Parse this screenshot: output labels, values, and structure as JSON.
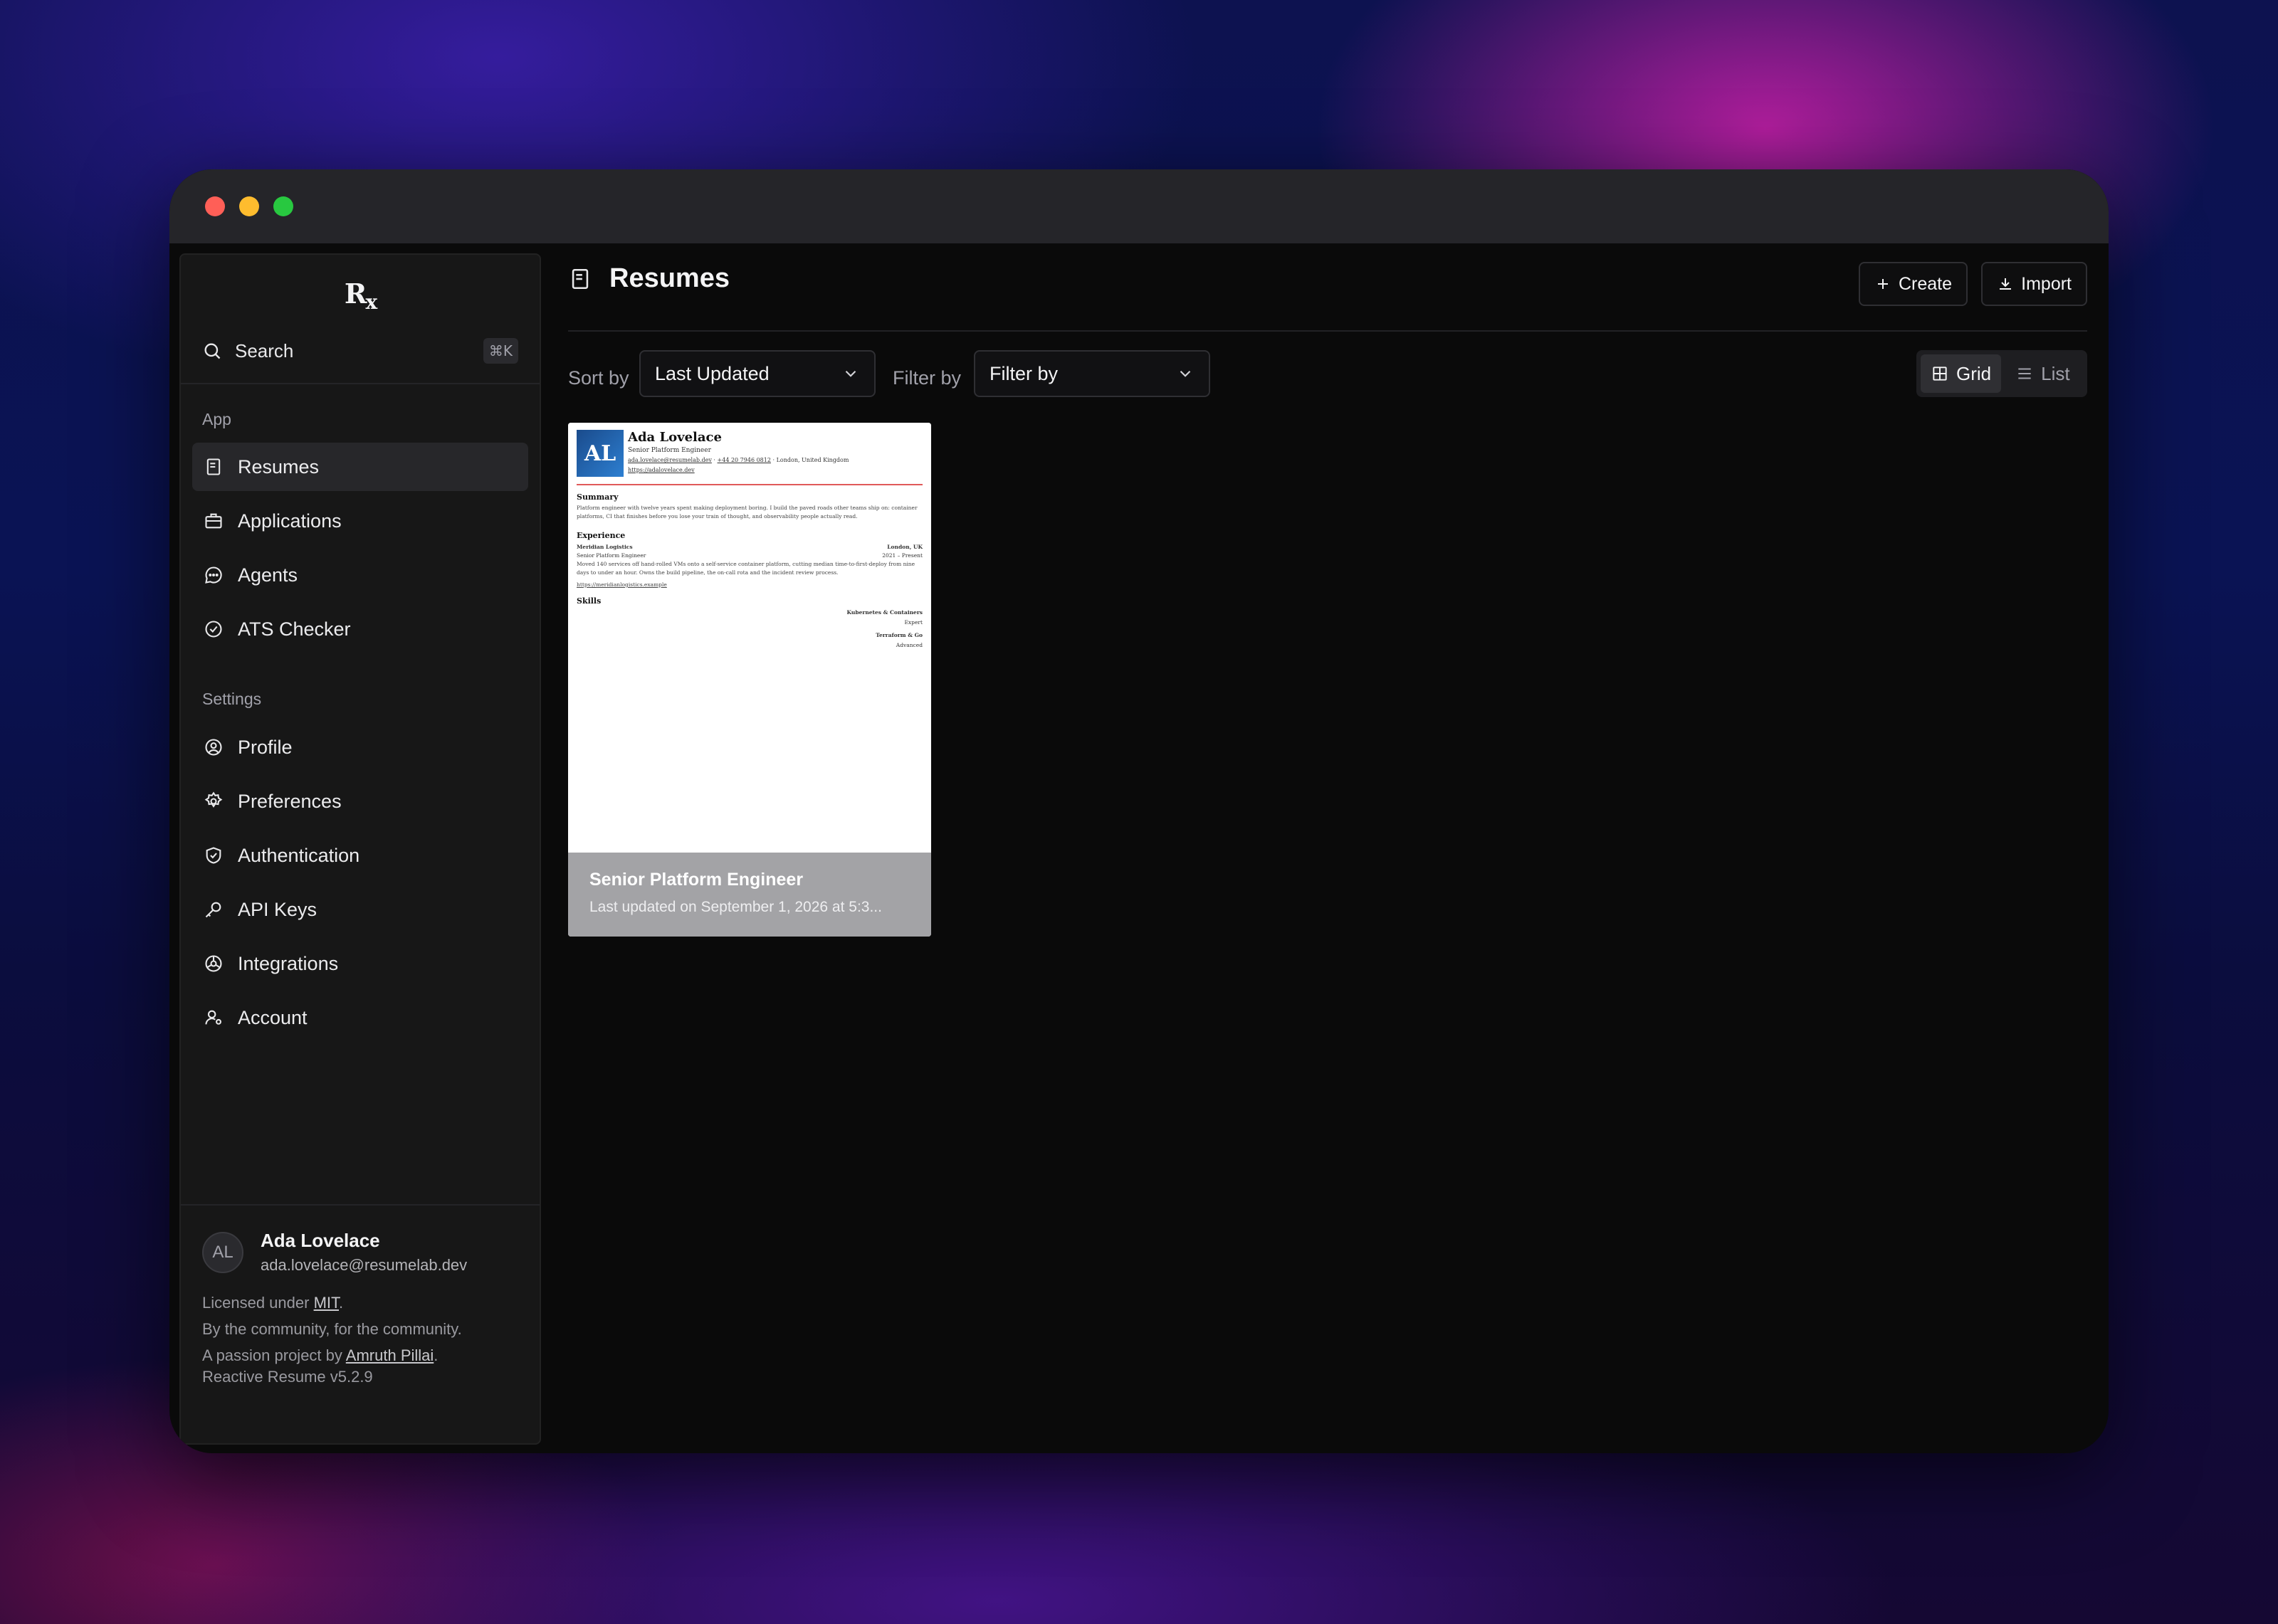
{
  "window": {
    "controls": [
      "close",
      "minimize",
      "maximize"
    ]
  },
  "sidebar": {
    "logo": "R",
    "logo_sub": "x",
    "search": {
      "label": "Search",
      "shortcut": "⌘K"
    },
    "app_label": "App",
    "app_items": [
      {
        "label": "Resumes",
        "icon": "file-text-icon",
        "active": true
      },
      {
        "label": "Applications",
        "icon": "briefcase-icon"
      },
      {
        "label": "Agents",
        "icon": "chat-icon"
      },
      {
        "label": "ATS Checker",
        "icon": "check-circle-icon"
      }
    ],
    "settings_label": "Settings",
    "settings_items": [
      {
        "label": "Profile",
        "icon": "user-circle-icon"
      },
      {
        "label": "Preferences",
        "icon": "gear-icon"
      },
      {
        "label": "Authentication",
        "icon": "shield-check-icon"
      },
      {
        "label": "API Keys",
        "icon": "key-icon"
      },
      {
        "label": "Integrations",
        "icon": "network-icon"
      },
      {
        "label": "Account",
        "icon": "user-gear-icon"
      }
    ],
    "user": {
      "initials": "AL",
      "name": "Ada Lovelace",
      "email": "ada.lovelace@resumelab.dev"
    },
    "footer": {
      "licensed_prefix": "Licensed under ",
      "license": "MIT",
      "licensed_suffix": ".",
      "community": "By the community, for the community.",
      "passion_prefix": "A passion project by ",
      "author": "Amruth Pillai",
      "passion_suffix": ".",
      "version": "Reactive Resume v5.2.9"
    }
  },
  "main": {
    "title": "Resumes",
    "create_label": "Create",
    "import_label": "Import",
    "sort_label": "Sort by",
    "sort_value": "Last Updated",
    "filter_label": "Filter by",
    "filter_value": "Filter by",
    "view": {
      "grid": "Grid",
      "list": "List",
      "selected": "Grid"
    }
  },
  "resume_card": {
    "title": "Senior Platform Engineer",
    "updated": "Last updated on September 1, 2026 at 5:3...",
    "preview": {
      "initials": "AL",
      "name": "Ada Lovelace",
      "headline": "Senior Platform Engineer",
      "email": "ada.lovelace@resumelab.dev",
      "phone": "+44 20 7946 0812",
      "location": "London, United Kingdom",
      "website": "https://adalovelace.dev",
      "summary_heading": "Summary",
      "summary": "Platform engineer with twelve years spent making deployment boring. I build the paved roads other teams ship on: container platforms, CI that finishes before you lose your train of thought, and observability people actually read.",
      "experience_heading": "Experience",
      "company": "Meridian Logistics",
      "company_location": "London, UK",
      "role": "Senior Platform Engineer",
      "period": "2021 – Present",
      "role_desc": "Moved 140 services off hand-rolled VMs onto a self-service container platform, cutting median time-to-first-deploy from nine days to under an hour. Owns the build pipeline, the on-call rota and the incident review process.",
      "company_url": "https://meridianlogistics.example",
      "skills_heading": "Skills",
      "skills": [
        {
          "name": "Kubernetes & Containers",
          "level": "Expert"
        },
        {
          "name": "Terraform & Go",
          "level": "Advanced"
        }
      ]
    }
  }
}
